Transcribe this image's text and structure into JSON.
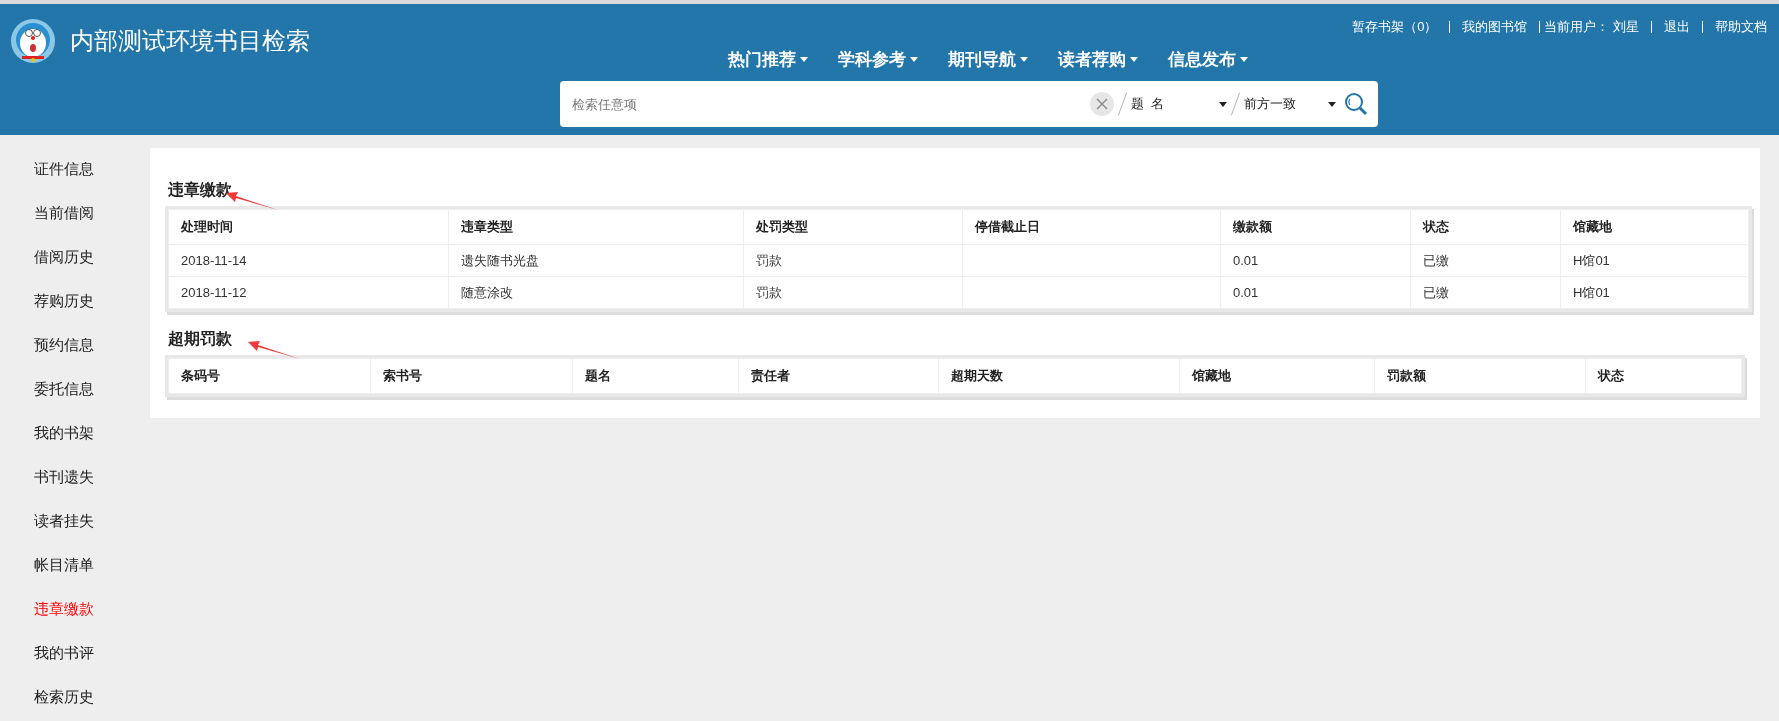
{
  "header": {
    "title": "内部测试环境书目检索",
    "top_links": [
      {
        "kind": "link",
        "text": "暂存书架（0）"
      },
      {
        "kind": "link",
        "text": "我的图书馆"
      },
      {
        "kind": "text",
        "text": "当前用户：  刘星"
      },
      {
        "kind": "link",
        "text": "退出"
      },
      {
        "kind": "link",
        "text": "帮助文档"
      }
    ],
    "nav": [
      "热门推荐",
      "学科参考",
      "期刊导航",
      "读者荐购",
      "信息发布"
    ],
    "search": {
      "placeholder": "检索任意项",
      "field": "题  名",
      "match": "前方一致"
    }
  },
  "sidebar": {
    "items": [
      {
        "label": "证件信息",
        "selected": false
      },
      {
        "label": "当前借阅",
        "selected": false
      },
      {
        "label": "借阅历史",
        "selected": false
      },
      {
        "label": "荐购历史",
        "selected": false
      },
      {
        "label": "预约信息",
        "selected": false
      },
      {
        "label": "委托信息",
        "selected": false
      },
      {
        "label": "我的书架",
        "selected": false
      },
      {
        "label": "书刊遗失",
        "selected": false
      },
      {
        "label": "读者挂失",
        "selected": false
      },
      {
        "label": "帐目清单",
        "selected": false
      },
      {
        "label": "违章缴款",
        "selected": true
      },
      {
        "label": "我的书评",
        "selected": false
      },
      {
        "label": "检索历史",
        "selected": false
      }
    ]
  },
  "sections": [
    {
      "title": "违章缴款",
      "columns": [
        "处理时间",
        "违章类型",
        "处罚类型",
        "停借截止日",
        "缴款额",
        "状态",
        "馆藏地"
      ],
      "rows": [
        [
          "2018-11-14",
          "遗失随书光盘",
          "罚款",
          "",
          "0.01",
          "已缴",
          "H馆01"
        ],
        [
          "2018-11-12",
          "随意涂改",
          "罚款",
          "",
          "0.01",
          "已缴",
          "H馆01"
        ]
      ]
    },
    {
      "title": "超期罚款",
      "columns": [
        "条码号",
        "索书号",
        "题名",
        "责任者",
        "超期天数",
        "馆藏地",
        "罚款额",
        "状态"
      ]
    }
  ]
}
